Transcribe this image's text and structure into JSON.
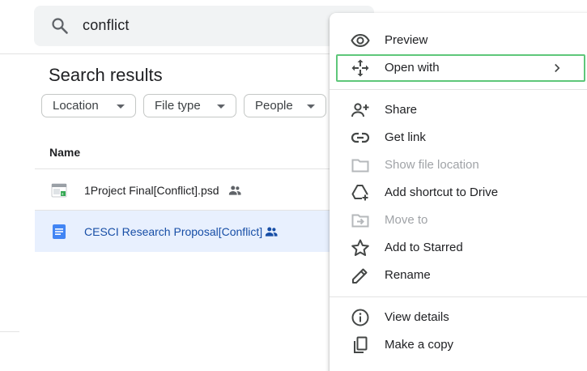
{
  "search": {
    "query": "conflict"
  },
  "results": {
    "title": "Search results",
    "filters": [
      {
        "label": "Location"
      },
      {
        "label": "File type"
      },
      {
        "label": "People"
      }
    ],
    "column_name": "Name",
    "files": [
      {
        "name": "1Project Final[Conflict].psd",
        "icon": "image-file-icon",
        "shared": true,
        "selected": false
      },
      {
        "name": "CESCI Research Proposal[Conflict]",
        "icon": "docs-file-icon",
        "shared": true,
        "selected": true
      }
    ]
  },
  "context_menu": {
    "items": [
      {
        "label": "Preview",
        "icon": "eye-icon",
        "enabled": true
      },
      {
        "label": "Open with",
        "icon": "move-arrows-icon",
        "enabled": true,
        "submenu": true,
        "highlighted": true
      },
      {
        "label": "Share",
        "icon": "person-add-icon",
        "enabled": true
      },
      {
        "label": "Get link",
        "icon": "link-icon",
        "enabled": true
      },
      {
        "label": "Show file location",
        "icon": "folder-icon",
        "enabled": false
      },
      {
        "label": "Add shortcut to Drive",
        "icon": "add-shortcut-icon",
        "enabled": true
      },
      {
        "label": "Move to",
        "icon": "move-to-folder-icon",
        "enabled": false
      },
      {
        "label": "Add to Starred",
        "icon": "star-icon",
        "enabled": true
      },
      {
        "label": "Rename",
        "icon": "pencil-icon",
        "enabled": true
      },
      {
        "label": "View details",
        "icon": "info-icon",
        "enabled": true
      },
      {
        "label": "Make a copy",
        "icon": "copy-icon",
        "enabled": true
      }
    ]
  },
  "colors": {
    "highlight_border": "#5ec77a",
    "selected_row_bg": "#e8f0fe",
    "selected_row_text": "#174ea6",
    "doc_icon_blue": "#4285f4",
    "disabled_text": "#a0a3a7"
  }
}
